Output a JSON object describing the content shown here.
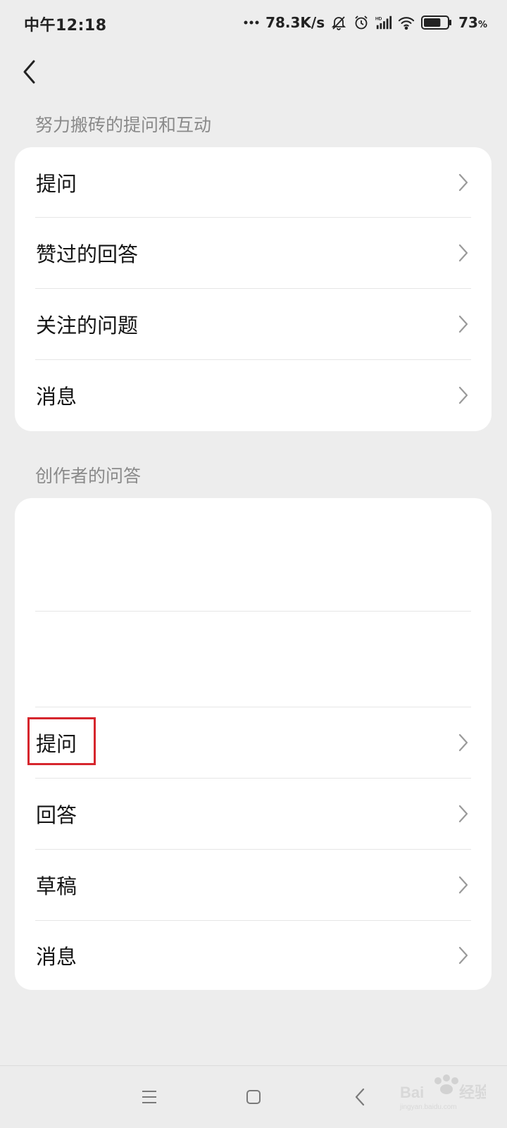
{
  "status_bar": {
    "time": "中午12:18",
    "net_speed": "78.3K/s",
    "battery_percent": "73",
    "battery_unit": "%",
    "battery_level": 0.73,
    "icons": [
      "dots-icon",
      "mute-bell-icon",
      "alarm-icon",
      "hd-signal-icon",
      "wifi-icon",
      "battery-icon"
    ]
  },
  "header": {
    "back_icon": "chevron-left-icon"
  },
  "section1": {
    "title": "努力搬砖的提问和互动",
    "items": [
      {
        "label": "提问"
      },
      {
        "label": "赞过的回答"
      },
      {
        "label": "关注的问题"
      },
      {
        "label": "消息"
      }
    ]
  },
  "section2": {
    "title": "创作者的问答",
    "items": [
      {
        "label": "提问"
      },
      {
        "label": "回答"
      },
      {
        "label": "草稿"
      },
      {
        "label": "消息"
      }
    ]
  },
  "nav": {
    "icons": [
      "menu-icon",
      "home-square-icon",
      "back-triangle-icon"
    ]
  },
  "colors": {
    "background": "#ededed",
    "card": "#ffffff",
    "highlight": "#d6262d",
    "section_title": "#8a8a8a"
  }
}
